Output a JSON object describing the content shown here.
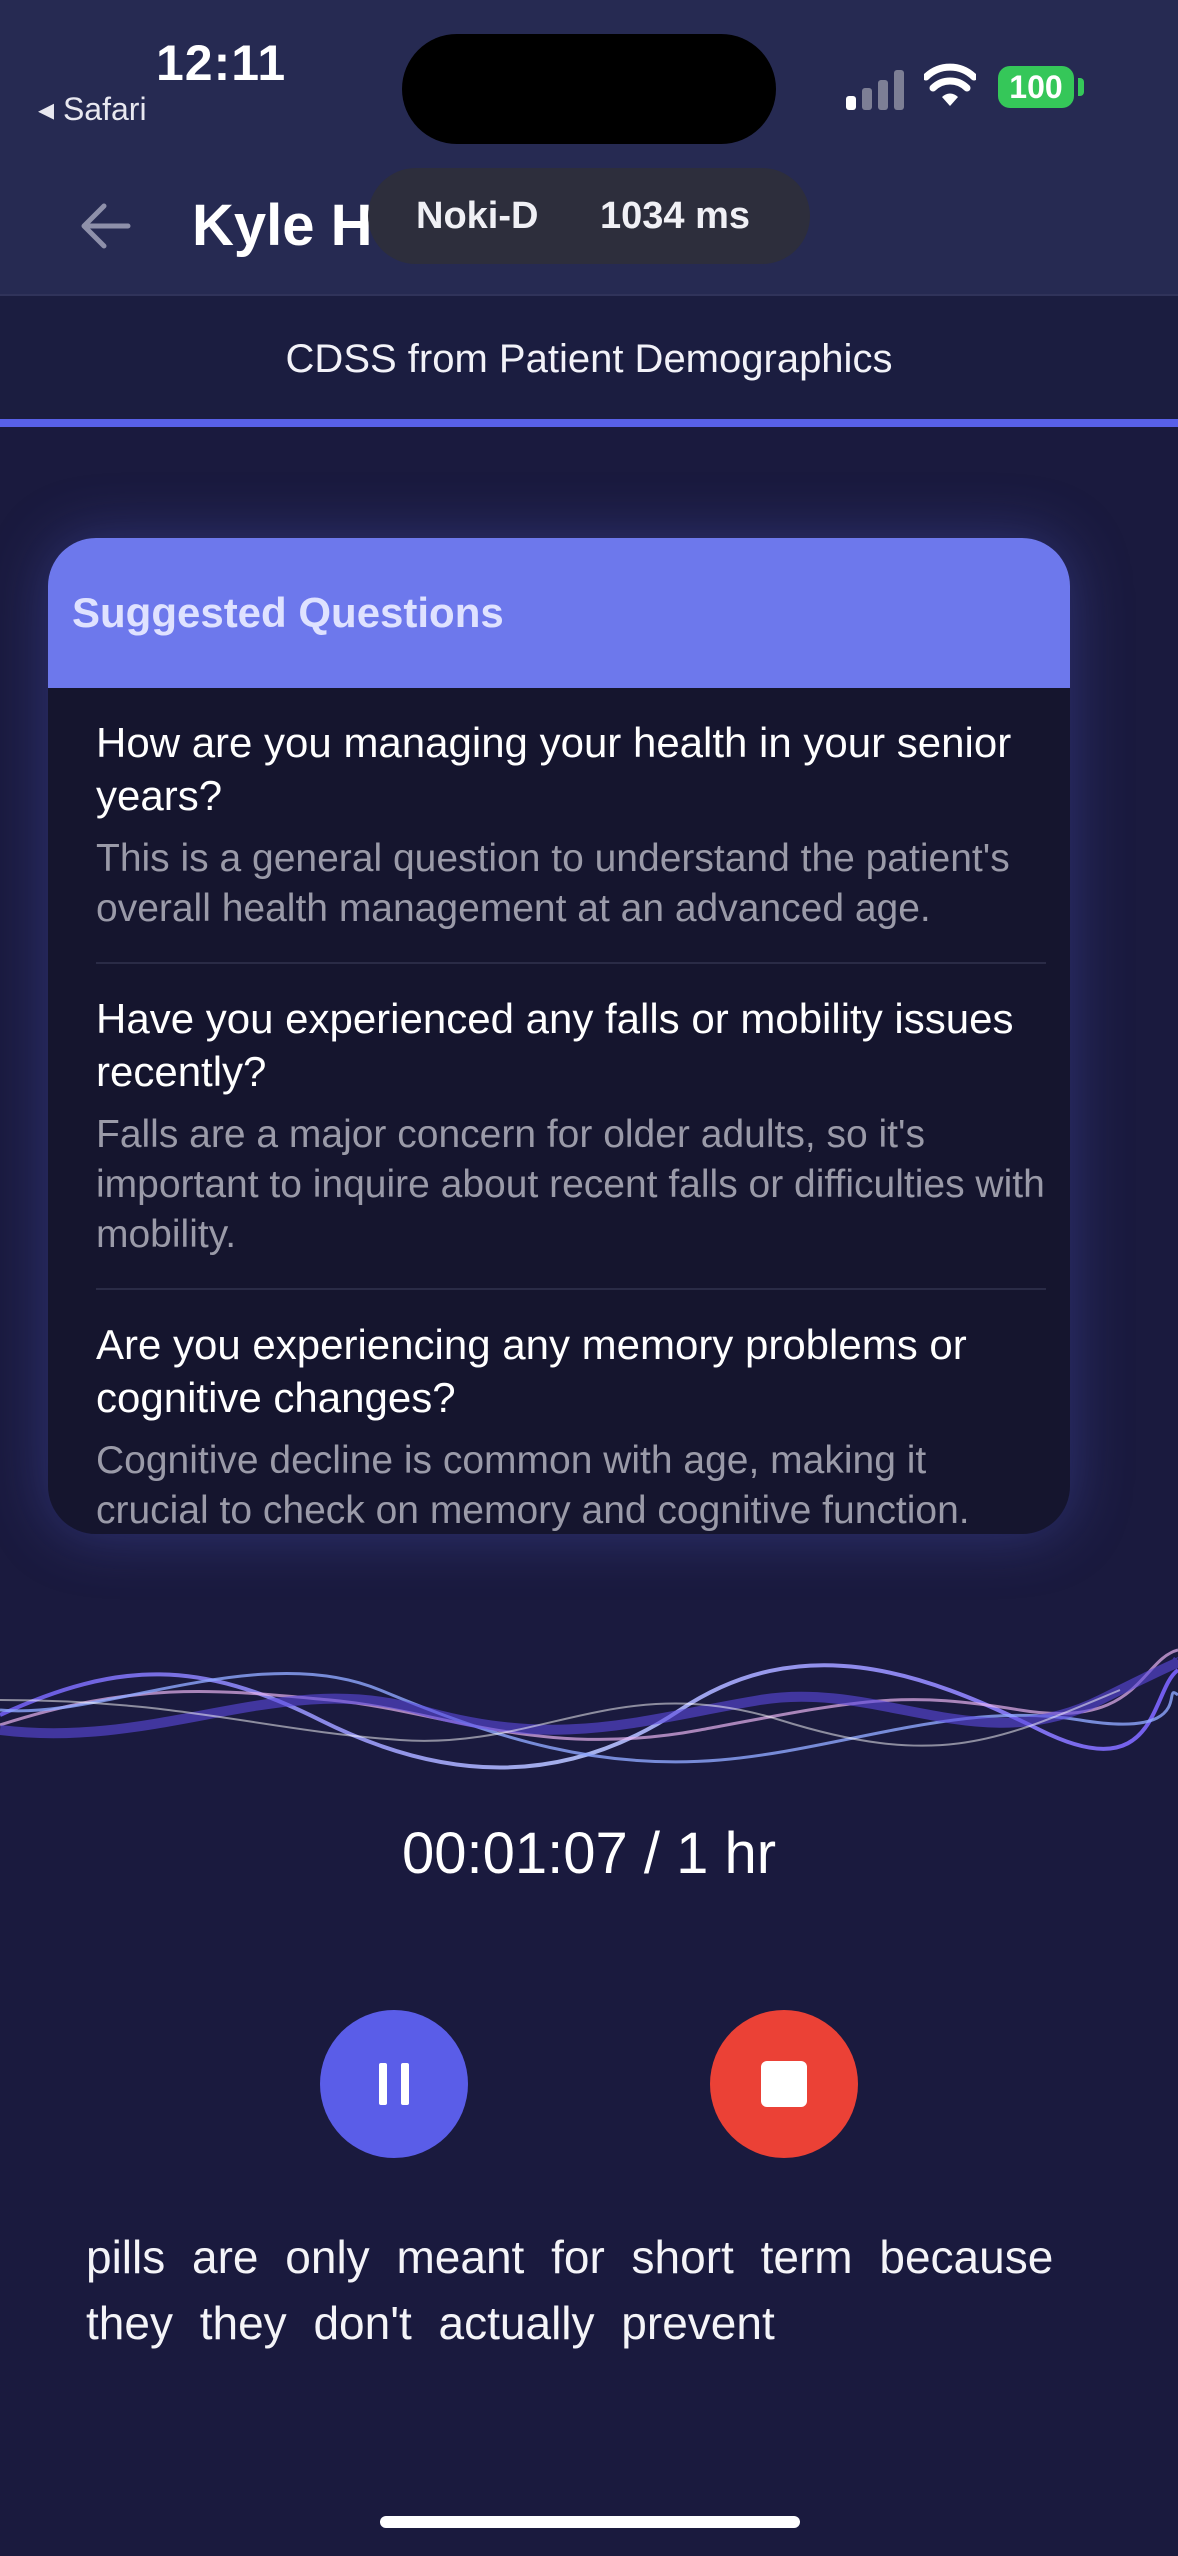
{
  "status_bar": {
    "time": "12:11",
    "back_app": "◂ Safari",
    "battery": "100",
    "battery_color": "#35c759"
  },
  "header": {
    "title": "Kyle H",
    "back_icon": "arrow-left-icon",
    "latency_label": "Noki-D",
    "latency_value": "1034 ms"
  },
  "subheader": {
    "title": "CDSS from Patient Demographics",
    "accent_color": "#5860e8"
  },
  "suggested_questions": {
    "header": "Suggested Questions",
    "header_color": "#6d78ec",
    "items": [
      {
        "question": "How are you managing your health in your senior years?",
        "description": "This is a general question to understand the patient's overall health management at an advanced age."
      },
      {
        "question": "Have you experienced any falls or mobility issues recently?",
        "description": "Falls are a major concern for older adults, so it's important to inquire about recent falls or difficulties with mobility."
      },
      {
        "question": "Are you experiencing any memory problems or cognitive changes?",
        "description": "Cognitive decline is common with age, making it crucial to check on memory and cognitive function."
      }
    ]
  },
  "recording": {
    "timer": "00:01:07 / 1 hr",
    "pause_icon": "pause-icon",
    "pause_color": "#5a5de8",
    "stop_icon": "stop-icon",
    "stop_color": "#eb4136"
  },
  "transcript": {
    "text": "pills are only meant for short term because they they don't actually prevent"
  }
}
